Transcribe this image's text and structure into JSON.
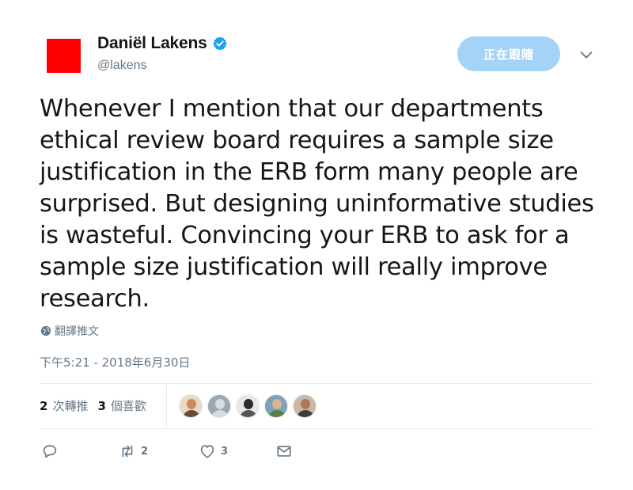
{
  "user": {
    "display_name": "Daniël Lakens",
    "handle": "@lakens",
    "avatar_color": "#ff0000",
    "verified": true
  },
  "follow_button": {
    "label": "正在跟隨",
    "color": "#a3d4f7"
  },
  "tweet": {
    "text": "Whenever I mention that our departments ethical review board requires a sample size justification in the ERB form many people are surprised. But designing uninformative studies is wasteful. Convincing your ERB to ask for a sample size justification will really improve research.",
    "translate_label": "翻譯推文",
    "timestamp": "下午5:21 - 2018年6月30日"
  },
  "stats": {
    "retweets_count": "2",
    "retweets_label": "次轉推",
    "likes_count": "3",
    "likes_label": "個喜歡"
  },
  "likers": [
    {
      "name": "liker-1"
    },
    {
      "name": "liker-2"
    },
    {
      "name": "liker-3"
    },
    {
      "name": "liker-4"
    },
    {
      "name": "liker-5"
    }
  ],
  "actions": {
    "reply_icon": "reply-icon",
    "retweet_icon": "retweet-icon",
    "retweet_count": "2",
    "like_icon": "heart-icon",
    "like_count": "3",
    "dm_icon": "envelope-icon"
  },
  "colors": {
    "text": "#14171a",
    "muted": "#657786",
    "divider": "#e6ecf0",
    "verified_blue": "#1da1f2"
  }
}
